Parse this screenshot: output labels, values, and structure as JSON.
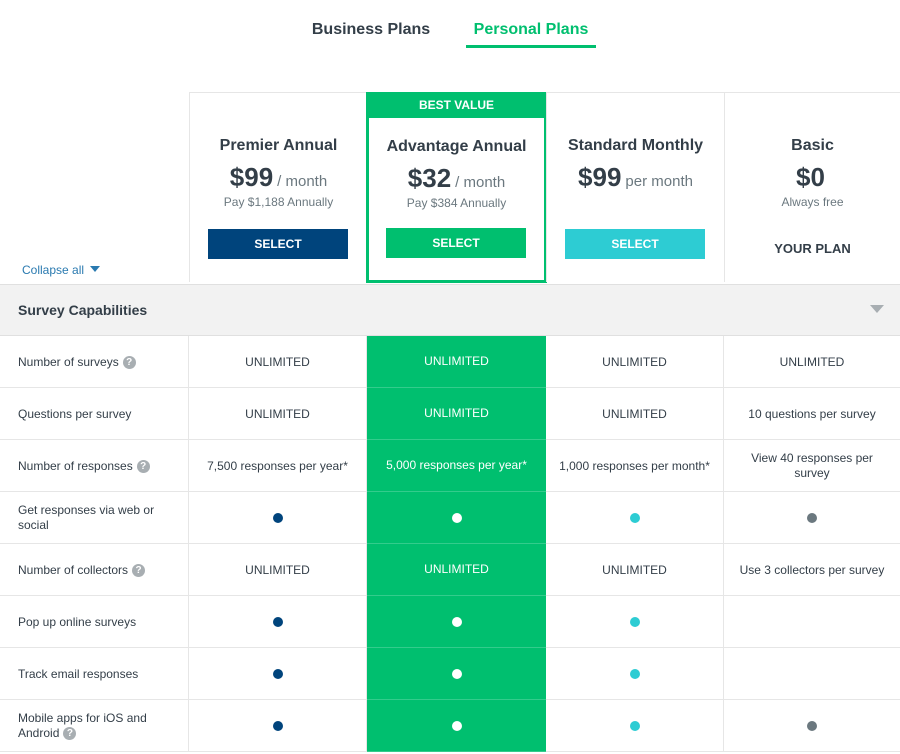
{
  "tabs": [
    {
      "label": "Business Plans",
      "active": false
    },
    {
      "label": "Personal Plans",
      "active": true
    }
  ],
  "colors": {
    "accent_green": "#00bf6f",
    "premier_blue": "#00447c",
    "standard_teal": "#2dccd3",
    "basic_gray": "#6b787f"
  },
  "plans": {
    "premier": {
      "name": "Premier Annual",
      "price": "$99",
      "period": "/ month",
      "billing": "Pay $1,188 Annually",
      "button": "SELECT"
    },
    "advantage": {
      "badge": "BEST VALUE",
      "name": "Advantage Annual",
      "price": "$32",
      "period": "/ month",
      "billing": "Pay $384 Annually",
      "button": "SELECT"
    },
    "standard": {
      "name": "Standard Monthly",
      "price": "$99",
      "period": "per month",
      "button": "SELECT"
    },
    "basic": {
      "name": "Basic",
      "price": "$0",
      "billing": "Always free",
      "status": "YOUR PLAN"
    }
  },
  "collapse_label": "Collapse all",
  "section": {
    "title": "Survey Capabilities"
  },
  "rows": [
    {
      "label": "Number of surveys",
      "help": true,
      "premier": "UNLIMITED",
      "advantage": "UNLIMITED",
      "standard": "UNLIMITED",
      "basic": "UNLIMITED"
    },
    {
      "label": "Questions per survey",
      "help": false,
      "premier": "UNLIMITED",
      "advantage": "UNLIMITED",
      "standard": "UNLIMITED",
      "basic": "10 questions per survey"
    },
    {
      "label": "Number of responses",
      "help": true,
      "premier": "7,500 responses per year*",
      "advantage": "5,000 responses per year*",
      "standard": "1,000 responses per month*",
      "basic": "View 40 responses per survey"
    },
    {
      "label": "Get responses via web or social",
      "help": false,
      "premier": "•",
      "advantage": "•",
      "standard": "•",
      "basic": "•"
    },
    {
      "label": "Number of collectors",
      "help": true,
      "premier": "UNLIMITED",
      "advantage": "UNLIMITED",
      "standard": "UNLIMITED",
      "basic": "Use 3 collectors per survey"
    },
    {
      "label": "Pop up online surveys",
      "help": false,
      "premier": "•",
      "advantage": "•",
      "standard": "•",
      "basic": ""
    },
    {
      "label": "Track email responses",
      "help": false,
      "premier": "•",
      "advantage": "•",
      "standard": "•",
      "basic": ""
    },
    {
      "label": "Mobile apps for iOS and Android",
      "help": true,
      "premier": "•",
      "advantage": "•",
      "standard": "•",
      "basic": "•"
    }
  ]
}
